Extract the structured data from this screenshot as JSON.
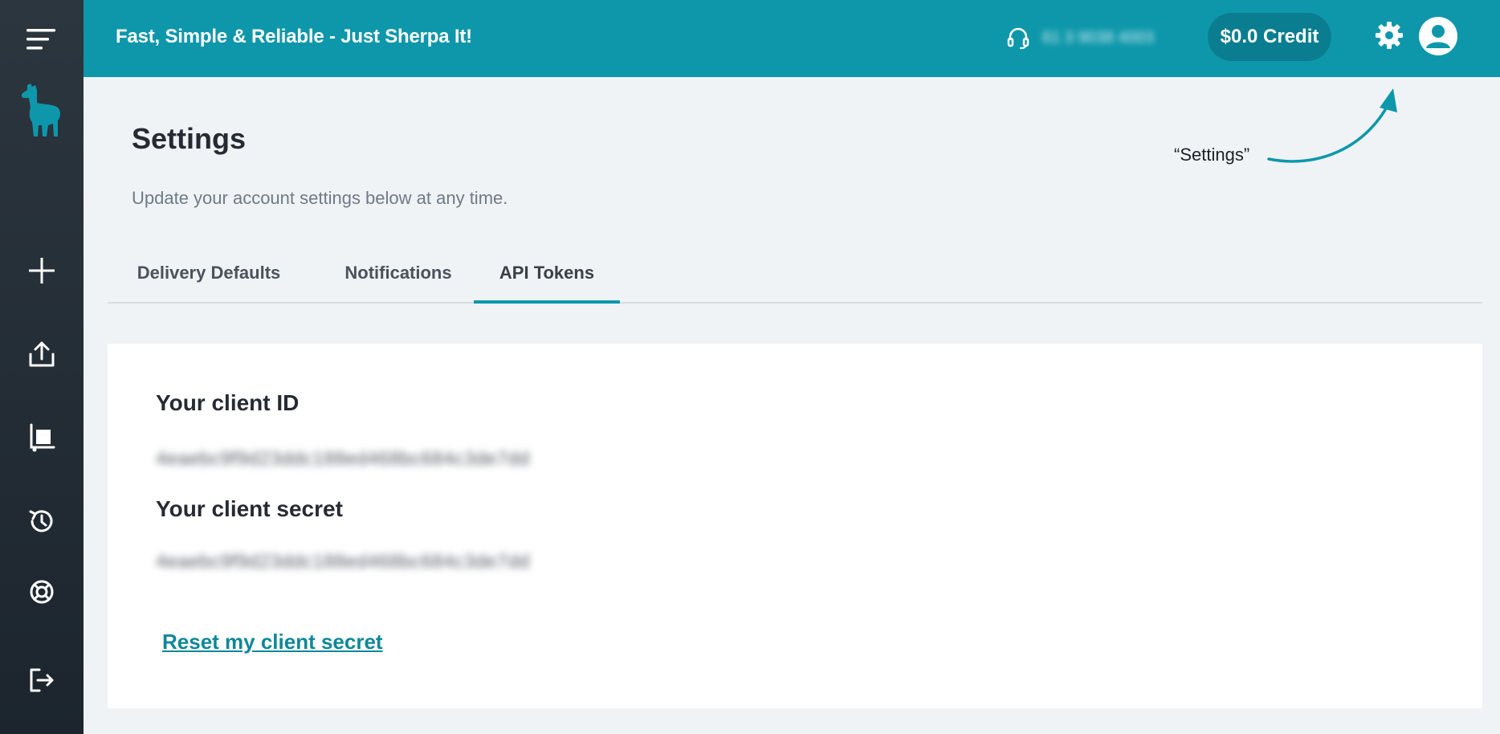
{
  "header": {
    "tagline": "Fast, Simple & Reliable - Just Sherpa It!",
    "phone": "61 3 9038 4003",
    "credit_label": "$0.0 Credit",
    "brand_color": "#0e97ab"
  },
  "sidebar": {
    "items": [
      {
        "name": "menu-icon"
      },
      {
        "name": "alpaca-logo"
      },
      {
        "name": "plus-icon"
      },
      {
        "name": "upload-icon"
      },
      {
        "name": "parcel-trolley-icon"
      },
      {
        "name": "history-icon"
      },
      {
        "name": "support-icon"
      },
      {
        "name": "logout-icon"
      }
    ]
  },
  "page": {
    "title": "Settings",
    "subtitle": "Update your account settings below at any time."
  },
  "annotation": {
    "text": "“Settings”"
  },
  "tabs": [
    {
      "label": "Delivery Defaults",
      "active": false
    },
    {
      "label": "Notifications",
      "active": false
    },
    {
      "label": "API Tokens",
      "active": true
    }
  ],
  "api_tokens": {
    "client_id_label": "Your client ID",
    "client_id_value": "4eaebc9f9d23ddc188ed468bc684c3de7dd",
    "client_secret_label": "Your client secret",
    "client_secret_value": "4eaebc9f9d23ddc188ed468bc684c3de7dd",
    "reset_link": "Reset my client secret"
  }
}
